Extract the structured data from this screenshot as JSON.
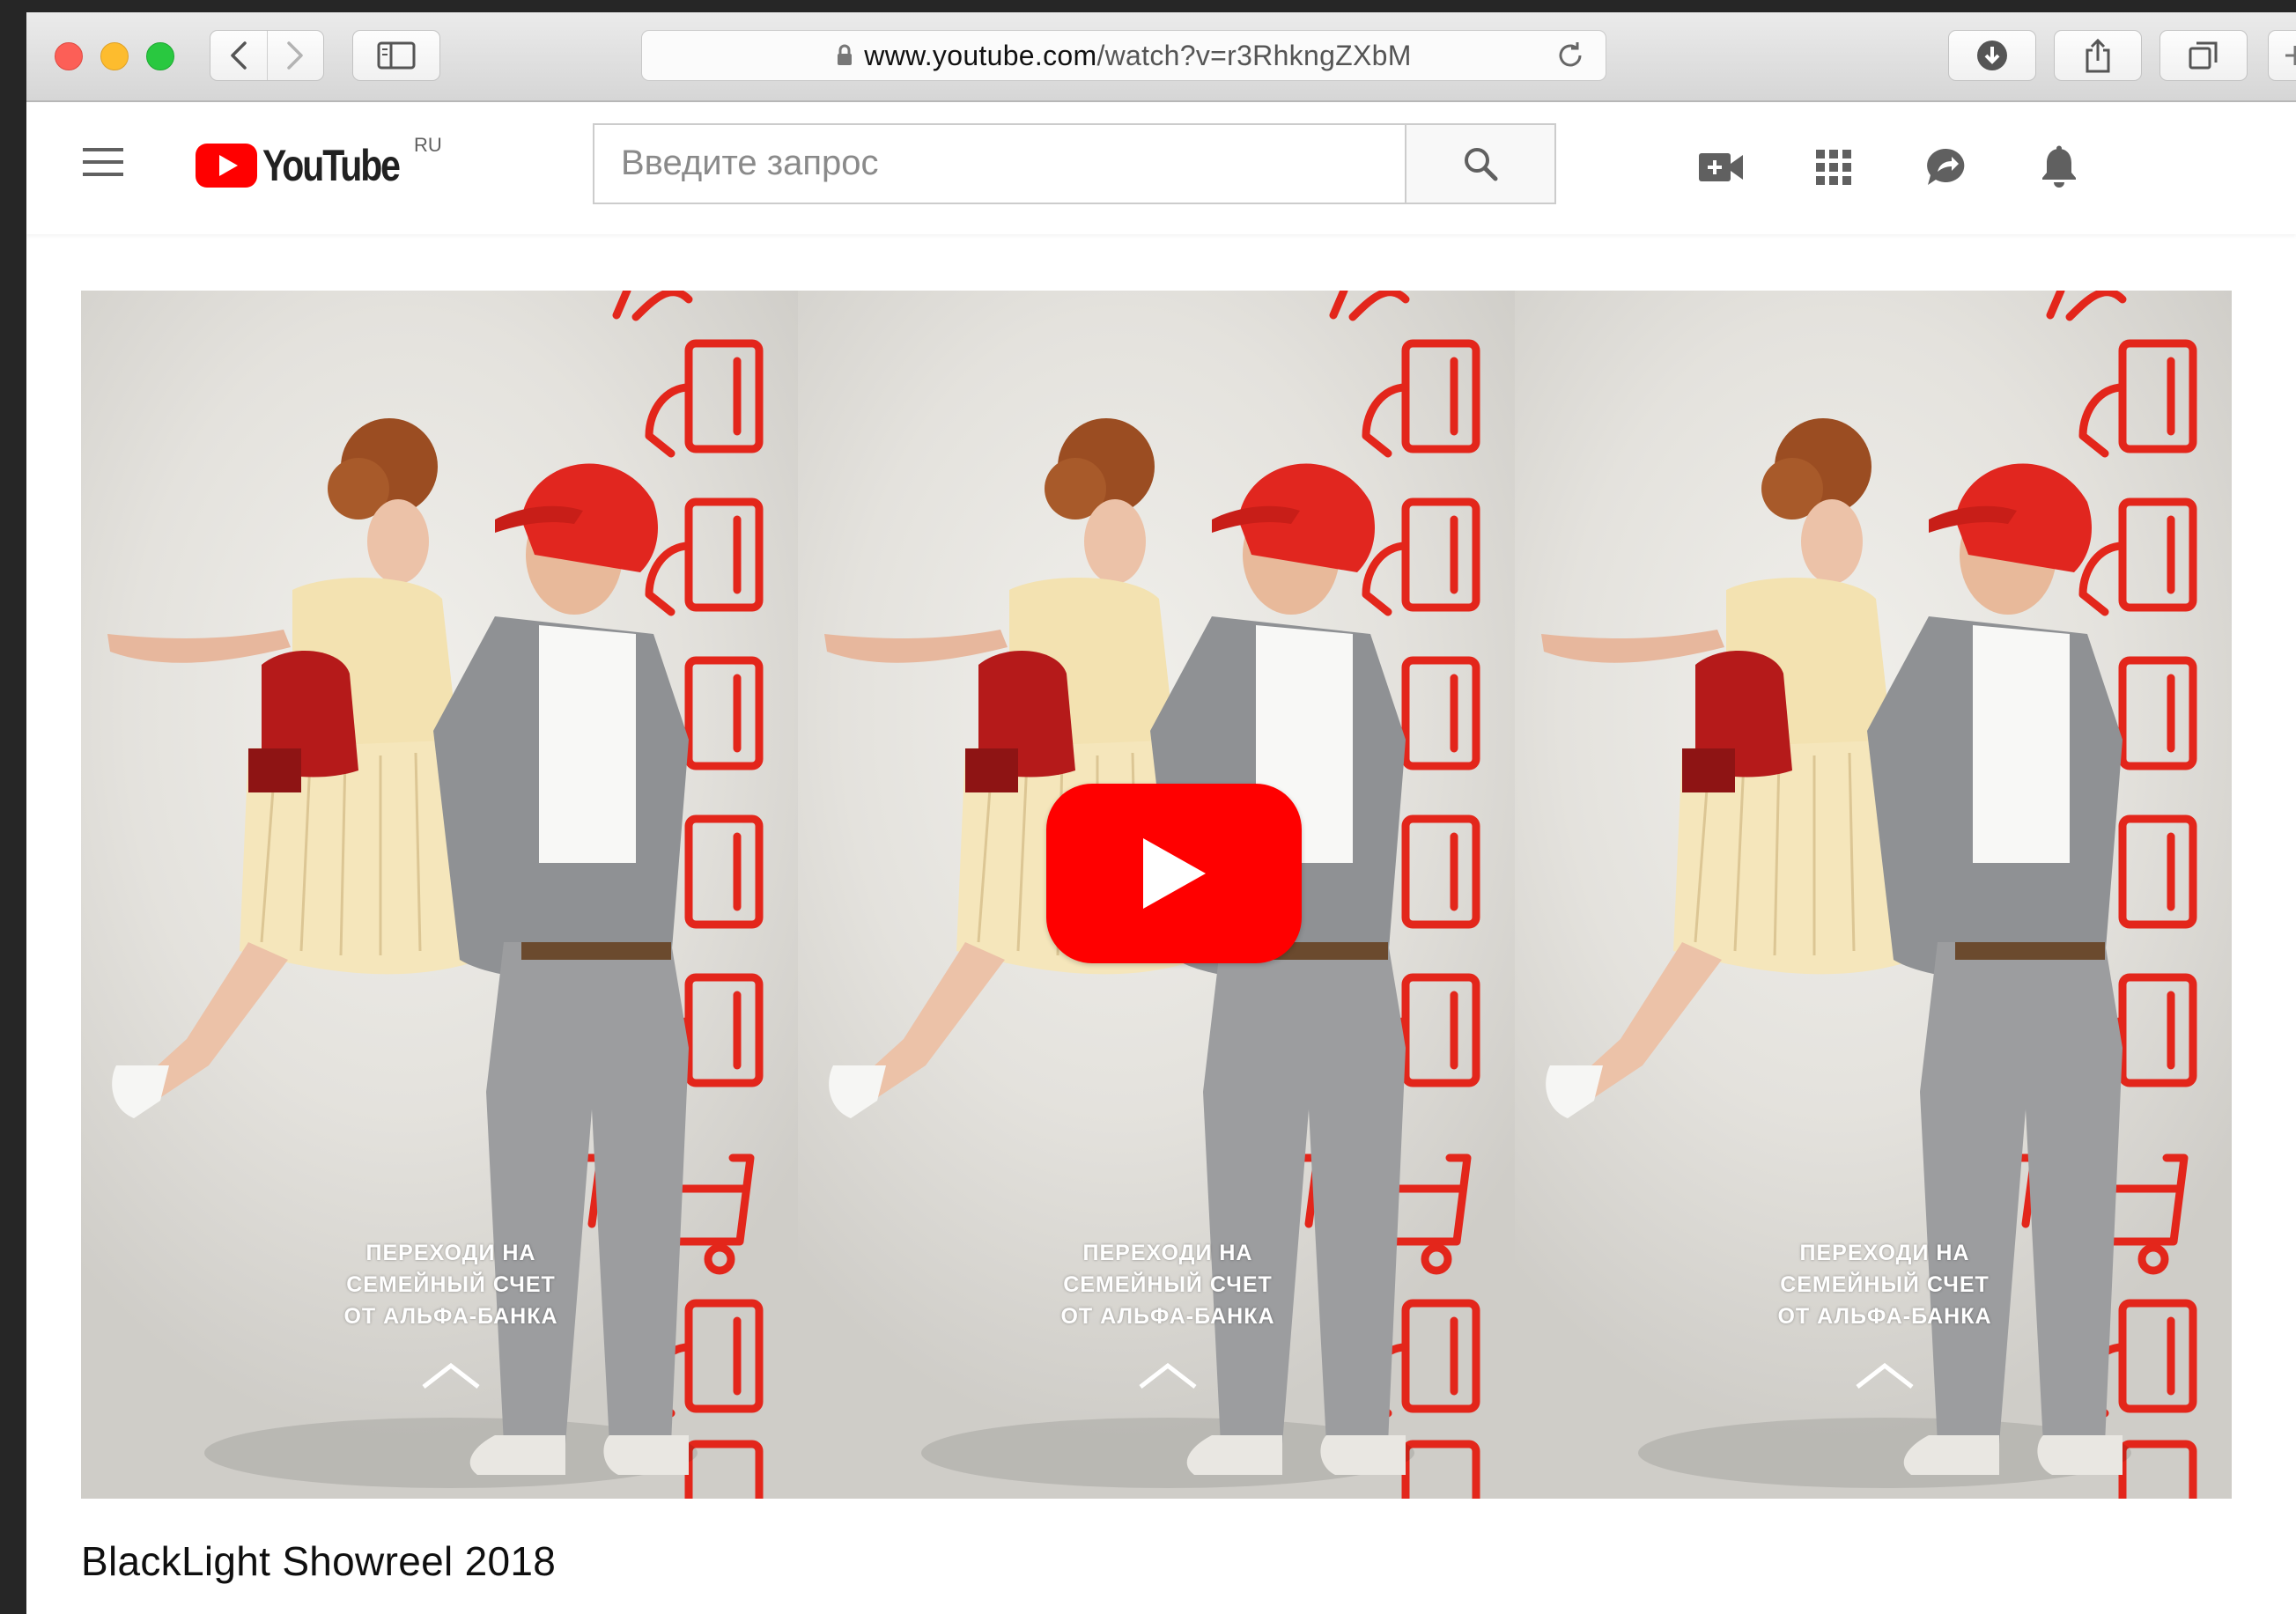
{
  "browser": {
    "url_domain": "www.youtube.com",
    "url_path": "/watch?v=r3RhkngZXbM"
  },
  "youtube": {
    "logo_text": "YouTube",
    "region": "RU",
    "search_placeholder": "Введите запрос",
    "brand_color": "#ff0000"
  },
  "video": {
    "title": "BlackLight Showreel 2018",
    "ad_caption": "ПЕРЕХОДИ НА\nСЕМЕЙНЫЙ СЧЕТ\nОТ АЛЬФА-БАНКА",
    "accent_color": "#e3261b"
  },
  "icons": [
    "close-light",
    "minimize-light",
    "zoom-light",
    "back-arrow-icon",
    "forward-arrow-icon",
    "sidebar-icon",
    "lock-icon",
    "reload-icon",
    "download-icon",
    "share-icon",
    "tabs-icon",
    "menu-icon",
    "search-icon",
    "create-video-icon",
    "apps-grid-icon",
    "messages-icon",
    "notifications-bell-icon",
    "play-icon"
  ]
}
